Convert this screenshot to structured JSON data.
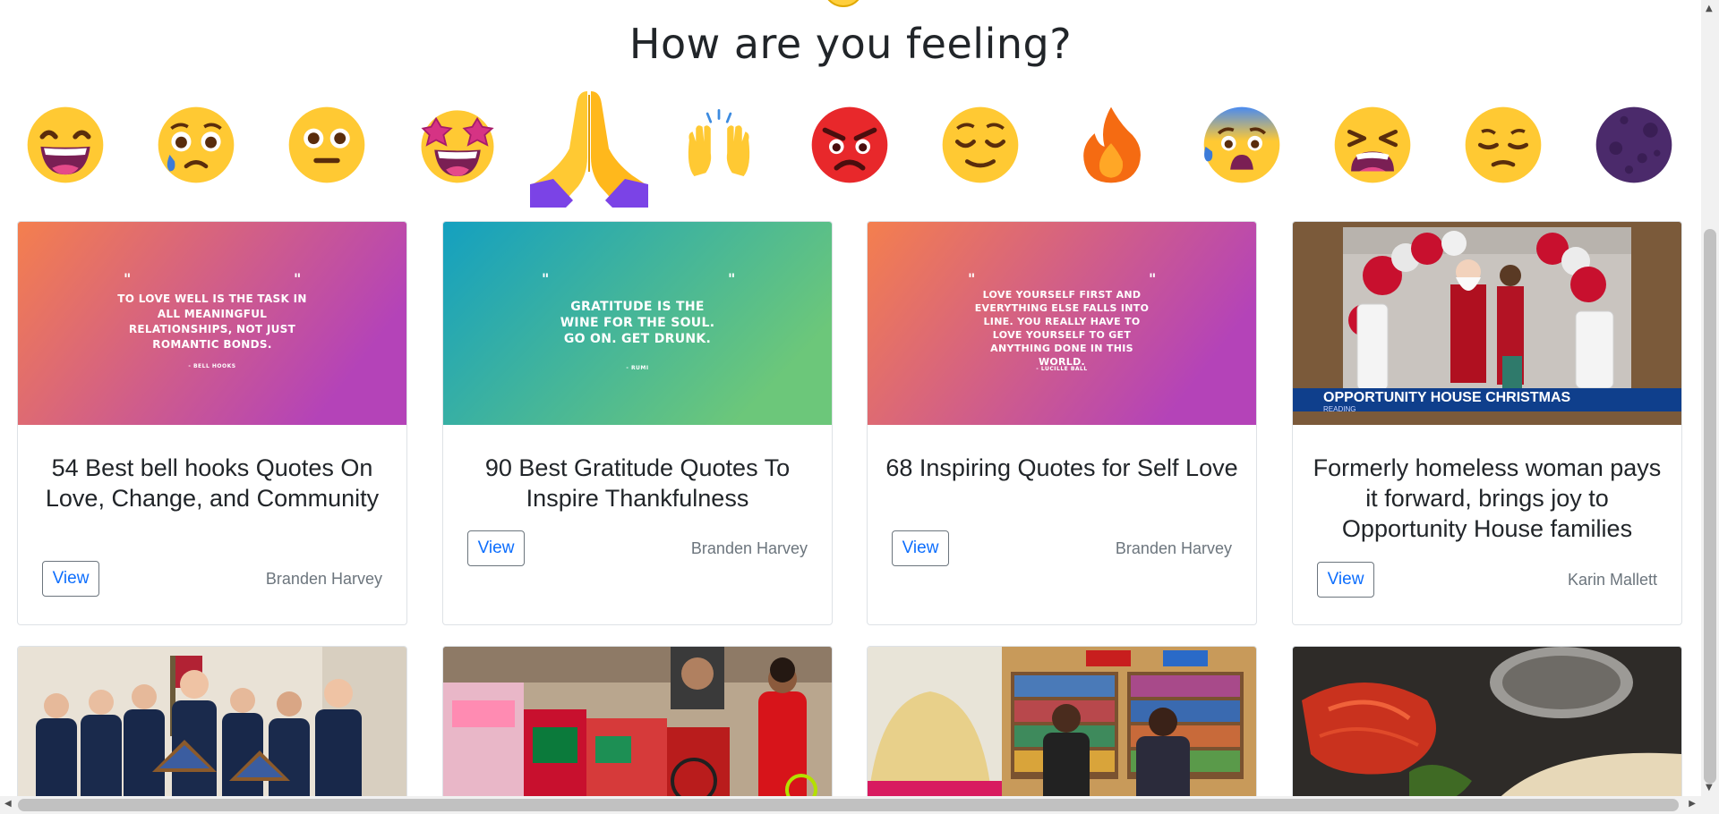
{
  "heading": "How are you feeling?",
  "emojis": [
    {
      "icon": "grinning-face-icon"
    },
    {
      "icon": "sad-tear-face-icon"
    },
    {
      "icon": "neutral-face-icon"
    },
    {
      "icon": "star-struck-face-icon"
    },
    {
      "icon": "folded-hands-icon"
    },
    {
      "icon": "raising-hands-icon"
    },
    {
      "icon": "angry-face-icon"
    },
    {
      "icon": "relieved-face-icon"
    },
    {
      "icon": "fire-icon"
    },
    {
      "icon": "anxious-sweat-face-icon"
    },
    {
      "icon": "tired-face-icon"
    },
    {
      "icon": "pensive-face-icon"
    },
    {
      "icon": "moon-icon"
    }
  ],
  "cards": [
    {
      "thumb_quote": "TO LOVE WELL IS THE TASK IN ALL MEANINGFUL RELATIONSHIPS, NOT JUST ROMANTIC BONDS.",
      "thumb_author": "- BELL HOOKS",
      "title": "54 Best bell hooks Quotes On Love, Change, and Community",
      "button": "View",
      "author": "Branden Harvey"
    },
    {
      "thumb_quote": "GRATITUDE IS THE WINE FOR THE SOUL. GO ON. GET DRUNK.",
      "thumb_author": "- RUMI",
      "title": "90 Best Gratitude Quotes To Inspire Thankfulness",
      "button": "View",
      "author": "Branden Harvey"
    },
    {
      "thumb_quote": "LOVE YOURSELF FIRST AND EVERYTHING ELSE FALLS INTO LINE. YOU REALLY HAVE TO LOVE YOURSELF TO GET ANYTHING DONE IN THIS WORLD.",
      "thumb_author": "- LUCILLE BALL",
      "title": "68 Inspiring Quotes for Self Love",
      "button": "View",
      "author": "Branden Harvey"
    },
    {
      "thumb_banner": "OPPORTUNITY HOUSE CHRISTMAS",
      "thumb_banner_sub": "READING",
      "title": "Formerly homeless woman pays it forward, brings joy to Opportunity House families",
      "button": "View",
      "author": "Karin Mallett"
    }
  ],
  "colors": {
    "link": "#0d6efd",
    "muted": "#6c757d",
    "border": "#dee2e6"
  }
}
